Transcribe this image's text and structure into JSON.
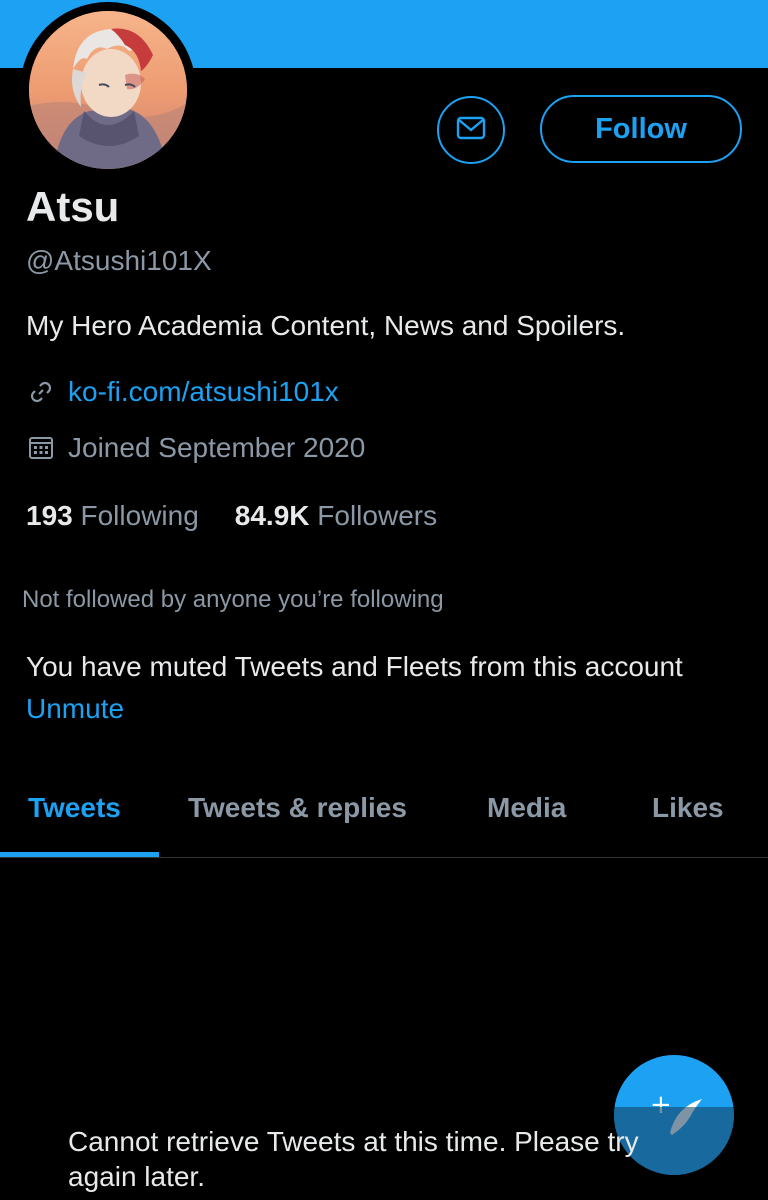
{
  "profile": {
    "name": "Atsu",
    "handle": "@Atsushi101X",
    "bio": "My Hero Academia Content, News and Spoilers.",
    "link": "ko-fi.com/atsushi101x",
    "joined": "Joined September 2020"
  },
  "actions": {
    "follow_label": "Follow",
    "message_icon": "envelope-icon"
  },
  "stats": {
    "following_count": "193",
    "following_label": "Following",
    "followers_count": "84.9K",
    "followers_label": "Followers"
  },
  "notices": {
    "not_followed": "Not followed by anyone you’re following",
    "muted_text": "You have muted Tweets and Fleets from this account",
    "unmute_label": "Unmute"
  },
  "tabs": [
    {
      "label": "Tweets",
      "active": true
    },
    {
      "label": "Tweets & replies",
      "active": false
    },
    {
      "label": "Media",
      "active": false
    },
    {
      "label": "Likes",
      "active": false
    }
  ],
  "feed": {
    "error": "Cannot retrieve Tweets at this time. Please try again later."
  },
  "fab": {
    "icon": "compose-tweet-icon"
  },
  "colors": {
    "accent": "#1da1f2",
    "background": "#000000",
    "secondary_text": "#8b98a5"
  }
}
